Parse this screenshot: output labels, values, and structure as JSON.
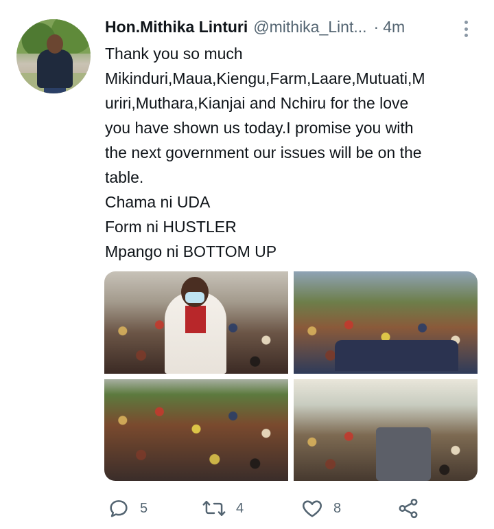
{
  "tweet": {
    "display_name": "Hon.Mithika Linturi",
    "handle": "@mithika_Lint...",
    "separator": "·",
    "time": "4m",
    "text_lines": [
      "Thank you so much",
      "Mikinduri,Maua,Kiengu,Farm,Laare,Mutuati,M",
      "uriri,Muthara,Kianjai and Nchiru for the love",
      "you have shown us today.I  promise you with",
      "the next government our issues will be on the",
      "table.",
      "Chama ni UDA",
      "Form ni HUSTLER",
      "Mpango ni BOTTOM UP"
    ]
  },
  "actions": {
    "reply_count": "5",
    "retweet_count": "4",
    "like_count": "8"
  },
  "icons": {
    "avatar": "profile-photo",
    "more": "more-vertical-icon",
    "reply": "reply-icon",
    "retweet": "retweet-icon",
    "like": "heart-icon",
    "share": "share-icon"
  },
  "colors": {
    "text_primary": "#0f1419",
    "text_secondary": "#536471",
    "icon": "#536471"
  }
}
